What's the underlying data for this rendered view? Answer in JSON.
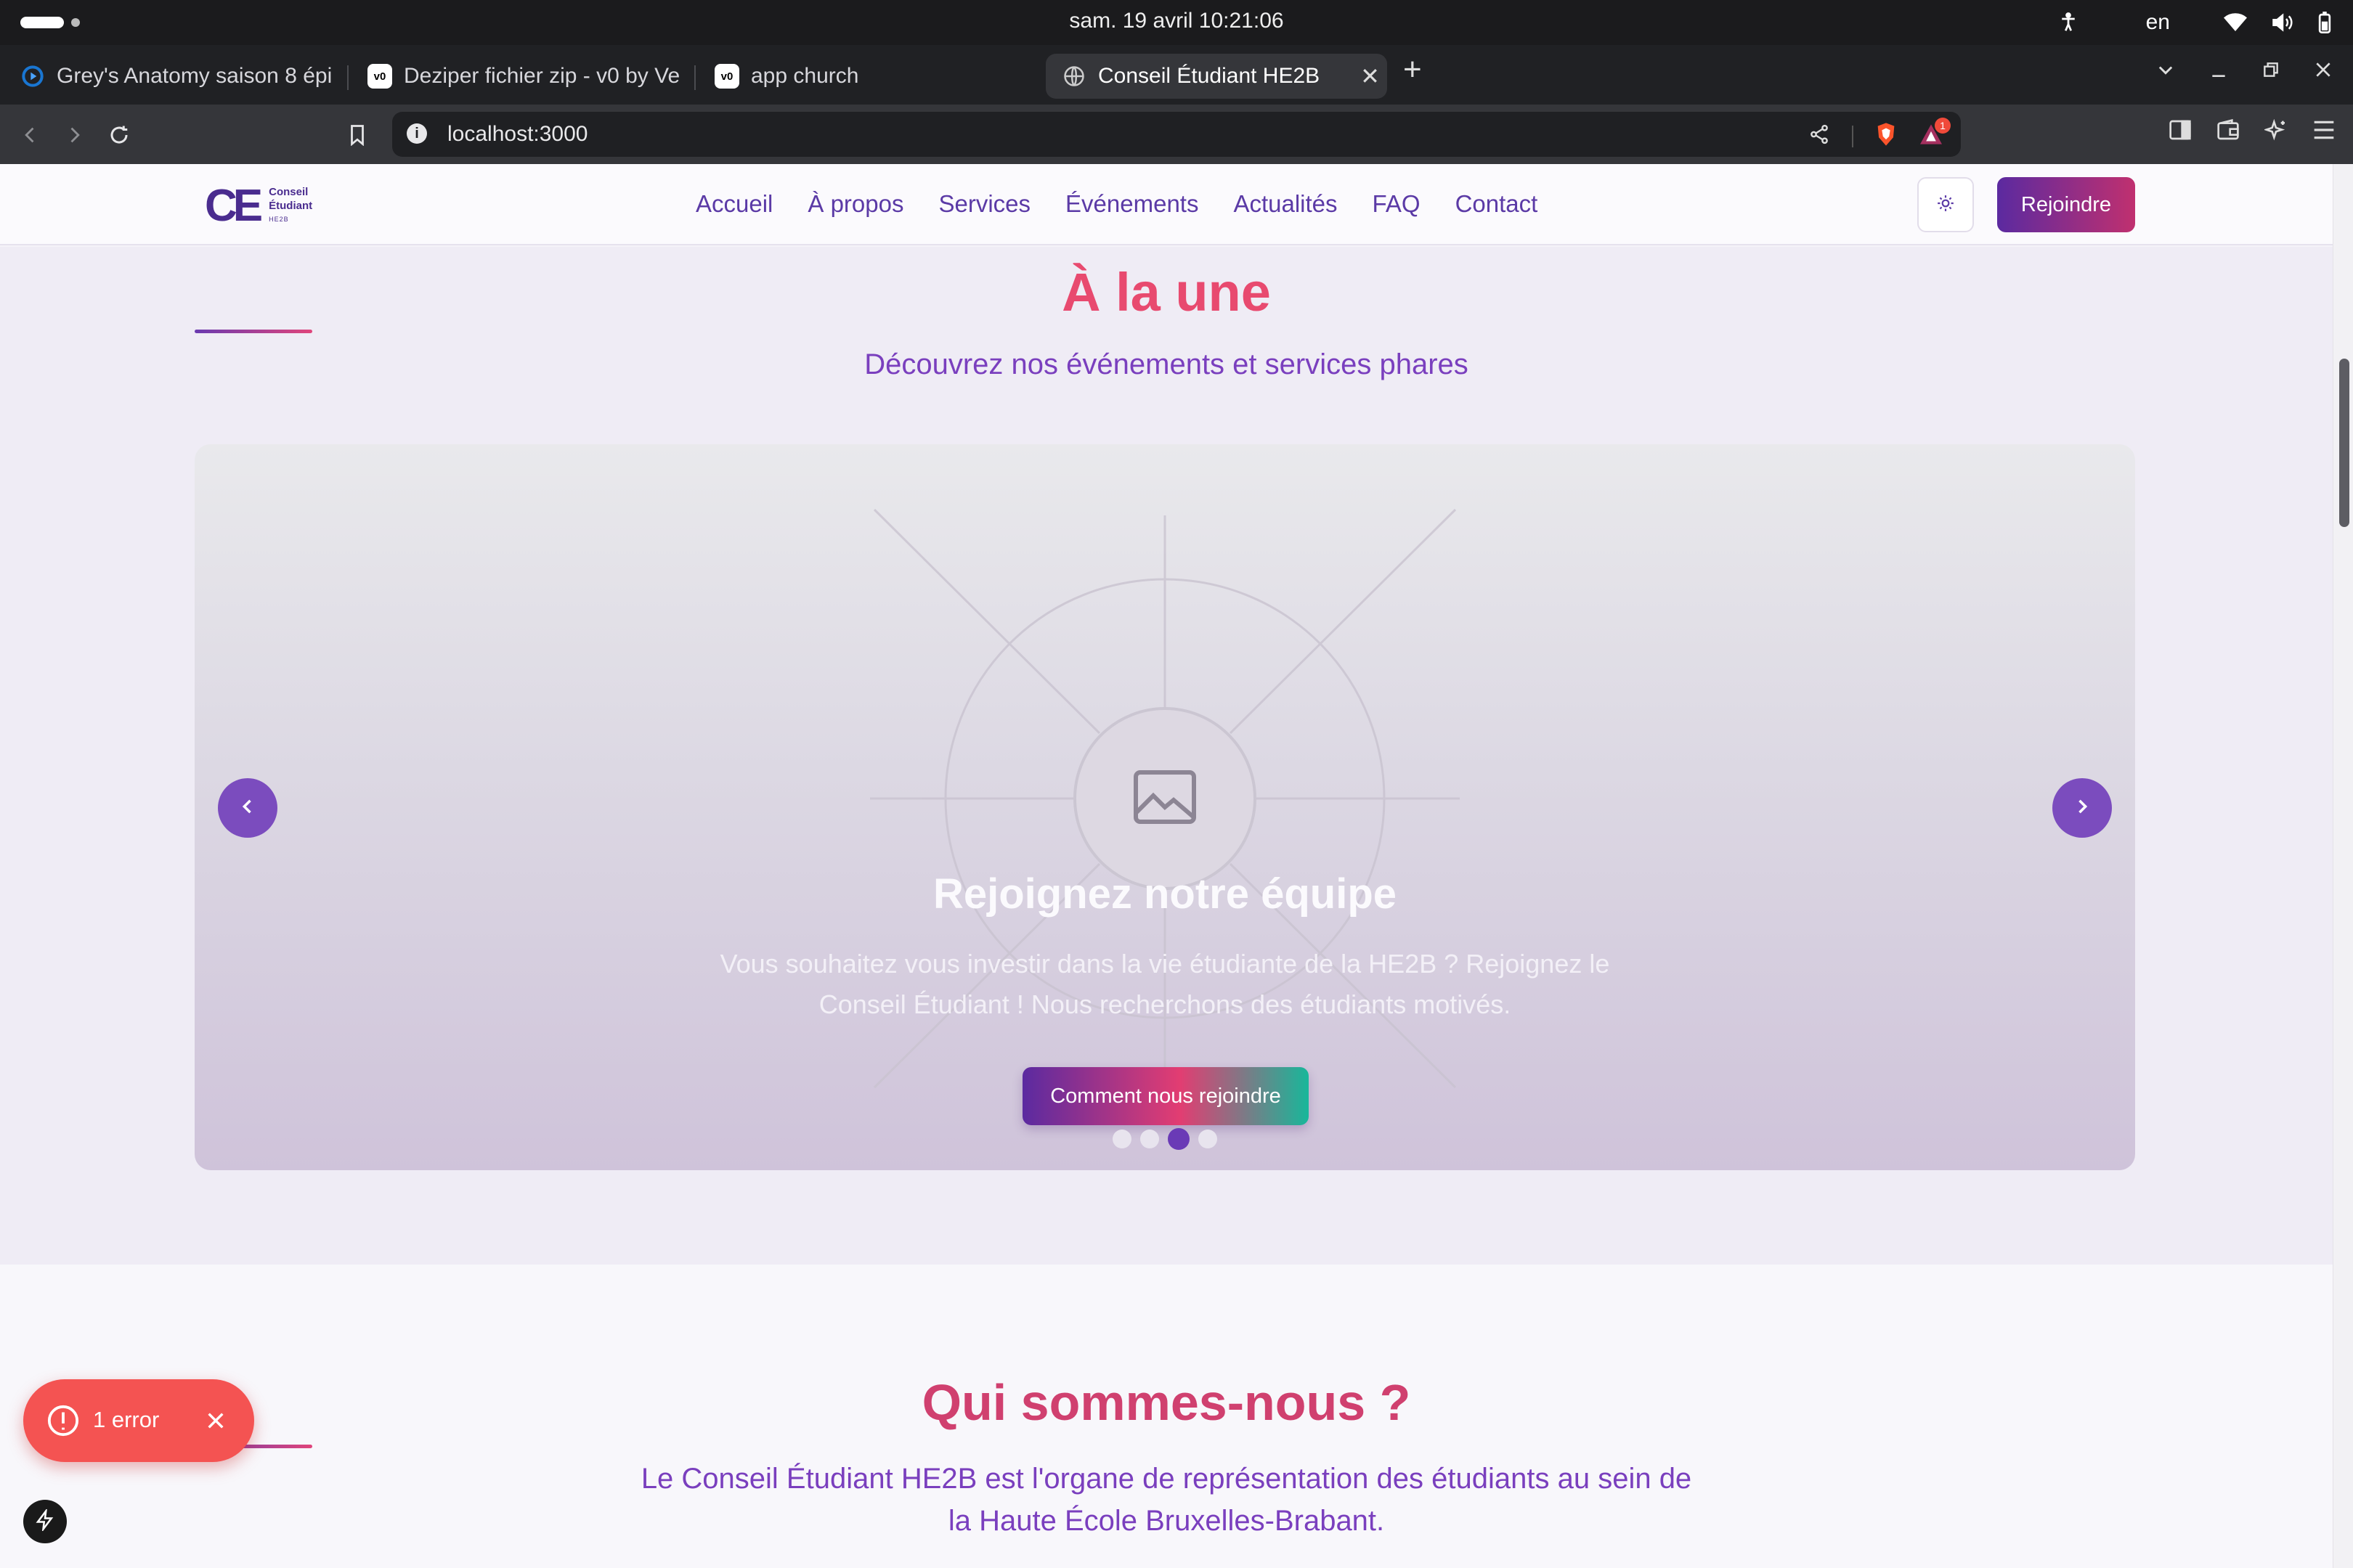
{
  "os": {
    "clock": "sam. 19 avril  10:21:06",
    "locale": "en",
    "icons": [
      "accessibility-icon",
      "wifi-icon",
      "volume-icon",
      "battery-icon"
    ]
  },
  "tabs": [
    {
      "title": "Grey's Anatomy saison 8 épi",
      "icon": "play-icon",
      "active": false
    },
    {
      "title": "Deziper fichier zip - v0 by Ve",
      "icon": "v0-icon",
      "active": false
    },
    {
      "title": "app church",
      "icon": "v0-icon",
      "active": false
    },
    {
      "title": "Conseil Étudiant HE2B",
      "icon": "globe-icon",
      "active": true
    }
  ],
  "address": {
    "url": "localhost:3000",
    "extension_badge": "1"
  },
  "site": {
    "logo_mark": "CE",
    "logo_line1": "Conseil",
    "logo_line2": "Étudiant",
    "logo_line3": "HE2B",
    "nav": [
      "Accueil",
      "À propos",
      "Services",
      "Événements",
      "Actualités",
      "FAQ",
      "Contact"
    ],
    "join_label": "Rejoindre"
  },
  "hero": {
    "title": "À la une",
    "subtitle": "Découvrez nos événements et services phares",
    "slide": {
      "title": "Rejoignez notre équipe",
      "text_line1": "Vous souhaitez vous investir dans la vie étudiante de la HE2B ? Rejoignez le",
      "text_line2": "Conseil Étudiant ! Nous recherchons des étudiants motivés.",
      "button": "Comment nous rejoindre"
    },
    "slide_count": 4,
    "active_slide": 3
  },
  "about": {
    "title": "Qui sommes-nous ?",
    "text_line1": "Le Conseil Étudiant HE2B est l'organe de représentation des étudiants au sein de",
    "text_line2": "la Haute École Bruxelles-Brabant."
  },
  "toast": {
    "label": "1 error"
  },
  "colors": {
    "brand_purple": "#5b2aa0",
    "brand_pink": "#e84a6f",
    "brand_teal": "#18b79a",
    "error_red": "#f45352"
  }
}
